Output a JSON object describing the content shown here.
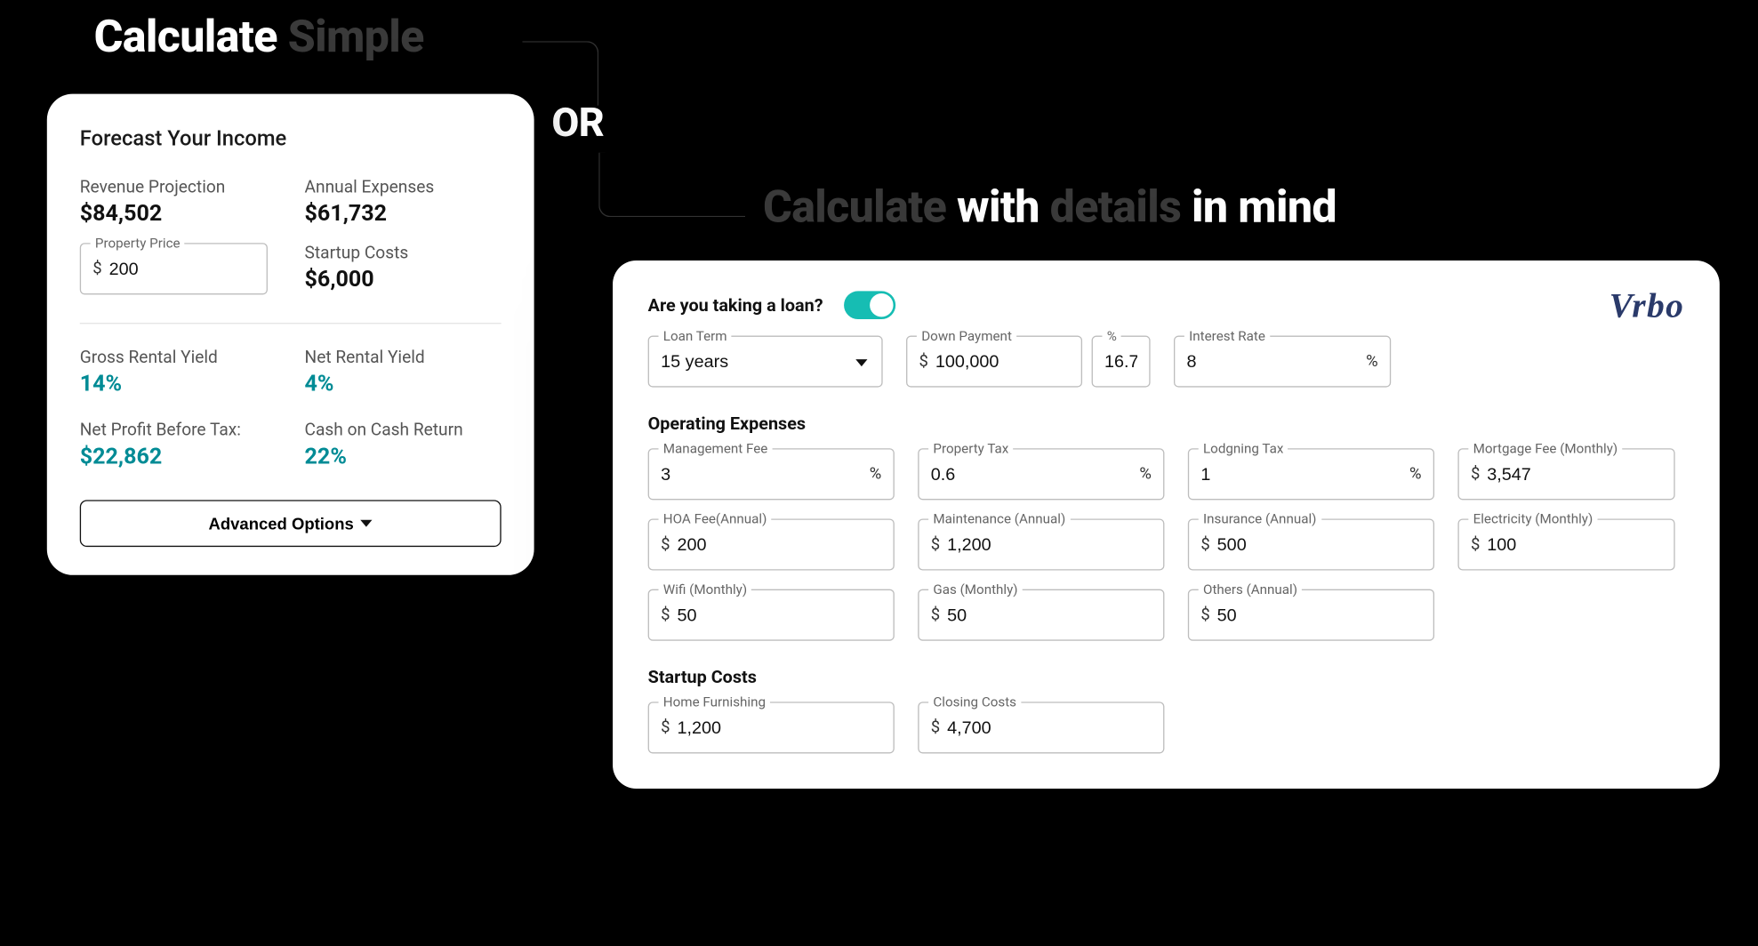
{
  "headlines": {
    "top_prefix": "Calculate ",
    "top_ghost": "Simple",
    "or": "OR",
    "right_ghost1": "Calculate",
    "right_white1": " with ",
    "right_ghost2": "details",
    "right_white2": " in mind"
  },
  "left_card": {
    "title": "Forecast Your Income",
    "revenue": {
      "label": "Revenue Projection",
      "value": "$84,502"
    },
    "expenses": {
      "label": "Annual Expenses",
      "value": "$61,732"
    },
    "property_price": {
      "label": "Property Price",
      "value": "200",
      "prefix": "$"
    },
    "startup_costs": {
      "label": "Startup Costs",
      "value": "$6,000"
    },
    "gross_yield": {
      "label": "Gross Rental Yield",
      "value": "14%"
    },
    "net_yield": {
      "label": "Net Rental Yield",
      "value": "4%"
    },
    "net_profit": {
      "label": "Net Profit Before Tax:",
      "value": "$22,862"
    },
    "cash_return": {
      "label": "Cash on Cash Return",
      "value": "22%"
    },
    "advanced_button": "Advanced Options"
  },
  "right_card": {
    "brand": "Vrbo",
    "loan_question": "Are you taking a loan?",
    "loan_toggle_on": true,
    "loan_term": {
      "label": "Loan Term",
      "value": "15 years"
    },
    "down_payment": {
      "label": "Down Payment",
      "prefix": "$",
      "value": "100,000"
    },
    "down_payment_pct": {
      "label": "%",
      "value": "16.7"
    },
    "interest_rate": {
      "label": "Interest Rate",
      "value": "8",
      "suffix": "%"
    },
    "operating_title": "Operating Expenses",
    "mgmt_fee": {
      "label": "Management Fee",
      "value": "3",
      "suffix": "%"
    },
    "property_tax": {
      "label": "Property Tax",
      "value": "0.6",
      "suffix": "%"
    },
    "lodging_tax": {
      "label": "Lodgning Tax",
      "value": "1",
      "suffix": "%"
    },
    "mortgage_fee": {
      "label": "Mortgage Fee (Monthly)",
      "prefix": "$",
      "value": "3,547"
    },
    "hoa": {
      "label": "HOA Fee(Annual)",
      "prefix": "$",
      "value": "200"
    },
    "maintenance": {
      "label": "Maintenance (Annual)",
      "prefix": "$",
      "value": "1,200"
    },
    "insurance": {
      "label": "Insurance (Annual)",
      "prefix": "$",
      "value": "500"
    },
    "electricity": {
      "label": "Electricity (Monthly)",
      "prefix": "$",
      "value": "100"
    },
    "wifi": {
      "label": "Wifi (Monthly)",
      "prefix": "$",
      "value": "50"
    },
    "gas": {
      "label": "Gas (Monthly)",
      "prefix": "$",
      "value": "50"
    },
    "others": {
      "label": "Others (Annual)",
      "prefix": "$",
      "value": "50"
    },
    "startup_title": "Startup Costs",
    "furnishing": {
      "label": "Home Furnishing",
      "prefix": "$",
      "value": "1,200"
    },
    "closing": {
      "label": "Closing Costs",
      "prefix": "$",
      "value": "4,700"
    }
  }
}
